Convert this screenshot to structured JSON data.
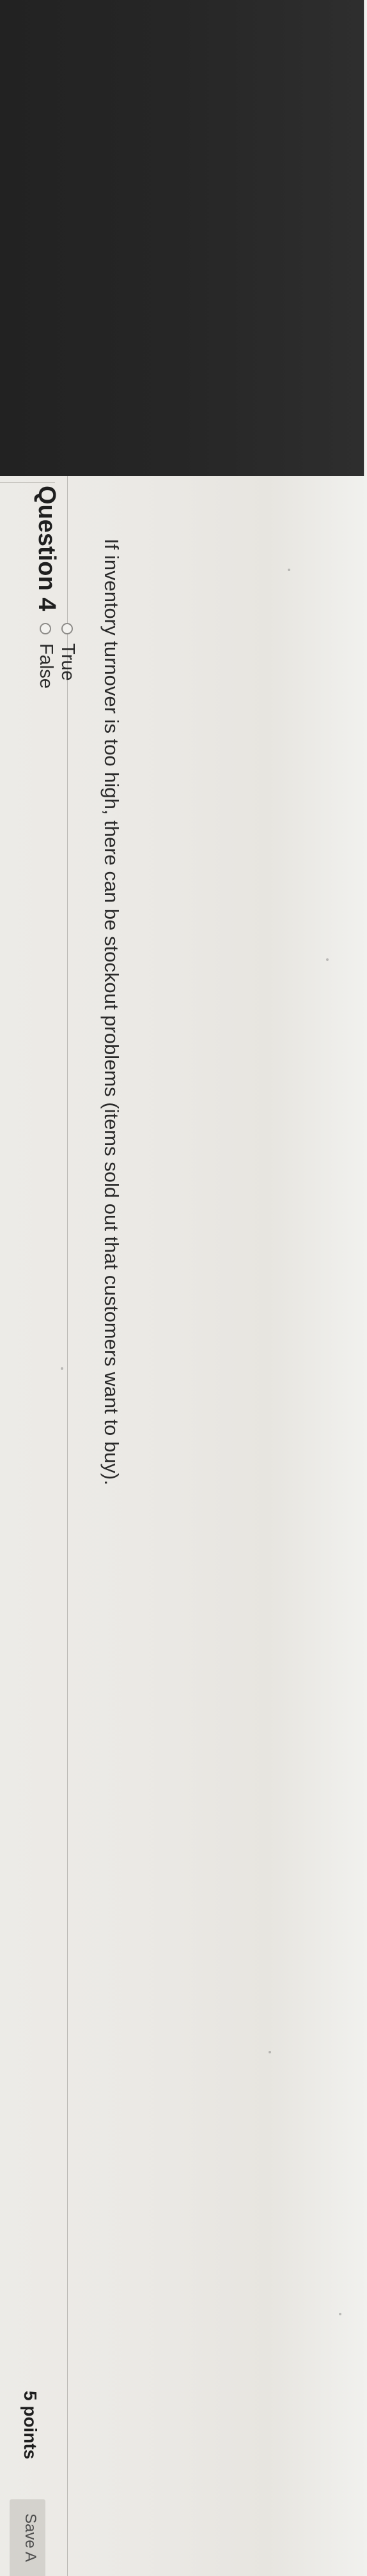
{
  "question": {
    "title": "Question 4",
    "points": "5 points",
    "save_label": "Save A",
    "prompt": "If inventory turnover is too high, there can be stockout problems (items sold out that customers want to buy).",
    "options": [
      {
        "label": "True",
        "selected": false
      },
      {
        "label": "False",
        "selected": false
      }
    ]
  },
  "colors": {
    "dark_area": "#262626",
    "background": "#e9e7e2",
    "text": "#1f1f1f",
    "save_box": "#d4d2cd"
  },
  "icons": {
    "option_marker": "radio-circle"
  }
}
